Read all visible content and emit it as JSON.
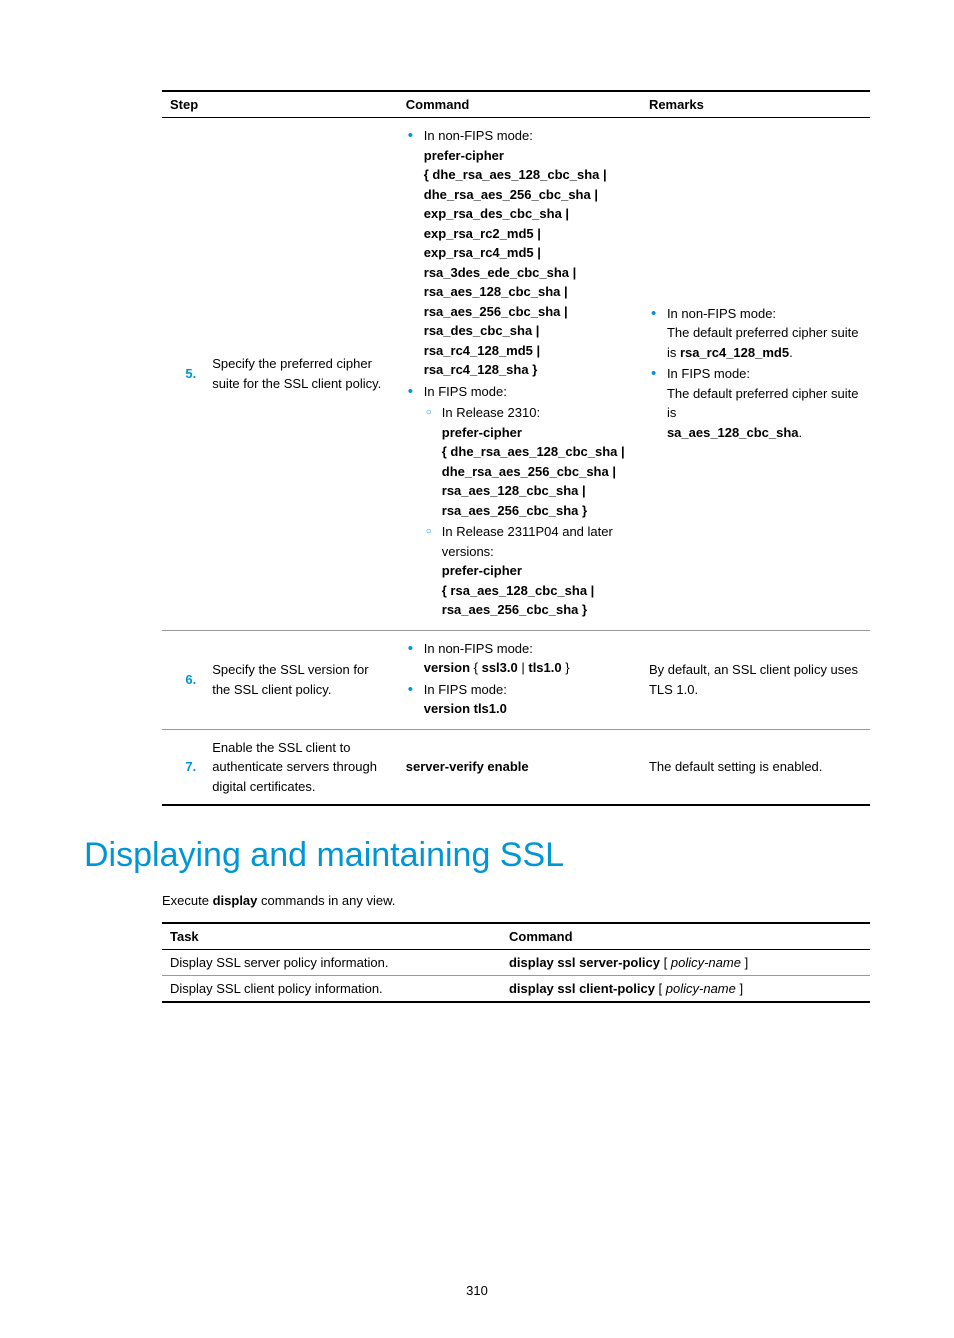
{
  "table1": {
    "headers": {
      "step": "Step",
      "command": "Command",
      "remarks": "Remarks"
    },
    "rows": [
      {
        "num": "5.",
        "desc": "Specify the preferred cipher suite for the SSL client policy.",
        "cmd": {
          "b1": "In non-FIPS mode:",
          "pc1": "prefer-cipher",
          "opts1a": "{ dhe_rsa_aes_128_cbc_sha | dhe_rsa_aes_256_cbc_sha | exp_rsa_des_cbc_sha | exp_rsa_rc2_md5 | exp_rsa_rc4_md5 | rsa_3des_ede_cbc_sha | rsa_aes_128_cbc_sha | rsa_aes_256_cbc_sha | rsa_des_cbc_sha | rsa_rc4_128_md5 | rsa_rc4_128_sha }",
          "b2": "In FIPS mode:",
          "s1": "In Release 2310:",
          "pc2": "prefer-cipher",
          "opts2": "{ dhe_rsa_aes_128_cbc_sha | dhe_rsa_aes_256_cbc_sha | rsa_aes_128_cbc_sha | rsa_aes_256_cbc_sha }",
          "s2": "In Release 2311P04 and later versions:",
          "pc3": "prefer-cipher",
          "opts3": "{ rsa_aes_128_cbc_sha | rsa_aes_256_cbc_sha }"
        },
        "rem": {
          "r1a": "In non-FIPS mode:",
          "r1b": "The default preferred cipher suite is ",
          "r1c": "rsa_rc4_128_md5",
          "r1d": ".",
          "r2a": "In FIPS mode:",
          "r2b": "The default preferred cipher suite is",
          "r2c": "sa_aes_128_cbc_sha",
          "r2d": "."
        }
      },
      {
        "num": "6.",
        "desc": "Specify the SSL version for the SSL client policy.",
        "cmd": {
          "b1": "In non-FIPS mode:",
          "l1a": "version",
          "l1b": " { ",
          "l1c": "ssl3.0",
          "l1d": " | ",
          "l1e": "tls1.0",
          "l1f": " }",
          "b2": "In FIPS mode:",
          "l2": "version tls1.0"
        },
        "rem": "By default, an SSL client policy uses TLS 1.0."
      },
      {
        "num": "7.",
        "desc": "Enable the SSL client to authenticate servers through digital certificates.",
        "cmd": "server-verify enable",
        "rem": "The default setting is enabled."
      }
    ]
  },
  "heading": "Displaying and maintaining SSL",
  "intro_a": "Execute ",
  "intro_b": "display",
  "intro_c": " commands in any view.",
  "table2": {
    "headers": {
      "task": "Task",
      "command": "Command"
    },
    "rows": [
      {
        "task": "Display SSL server policy information.",
        "c1": "display ssl server-policy",
        "c2": " [ ",
        "c3": "policy-name",
        "c4": " ]"
      },
      {
        "task": "Display SSL client policy information.",
        "c1": "display ssl client-policy",
        "c2": " [ ",
        "c3": "policy-name",
        "c4": " ]"
      }
    ]
  },
  "page": "310"
}
